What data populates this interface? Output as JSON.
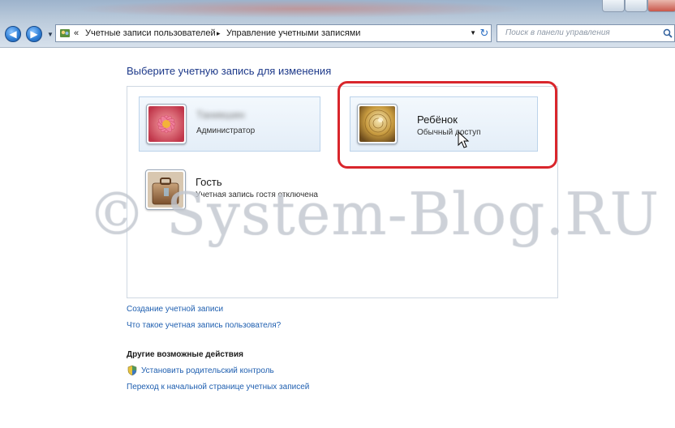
{
  "window": {
    "breadcrumb": {
      "double_chevron": "«",
      "segment_1": "Учетные записи пользователей",
      "separator": "▸",
      "segment_2": "Управление учетными записями"
    },
    "search": {
      "placeholder": "Поиск в панели управления"
    }
  },
  "main": {
    "title": "Выберите учетную запись для изменения",
    "accounts": [
      {
        "name": "Таникшин",
        "type": "Администратор",
        "avatar_icon": "flower-icon",
        "name_obscured": true
      },
      {
        "name": "Ребёнок",
        "type": "Обычный доступ",
        "avatar_icon": "golden-spiral-icon",
        "highlighted": true
      },
      {
        "name": "Гость",
        "type": "Учетная запись гостя отключена",
        "avatar_icon": "guest-suitcase-icon"
      }
    ],
    "links": {
      "create_account": "Создание учетной записи",
      "what_is_account": "Что такое учетная запись пользователя?"
    },
    "other_actions": {
      "heading": "Другие возможные действия",
      "parental_control": "Установить родительский контроль",
      "accounts_home": "Переход к начальной странице учетных записей"
    }
  },
  "watermark": "© System-Blog.RU",
  "colors": {
    "link": "#1f5fb0",
    "title": "#1e3a8a",
    "highlight_ring": "#d9262c",
    "tile_border": "#bcd3ea"
  }
}
